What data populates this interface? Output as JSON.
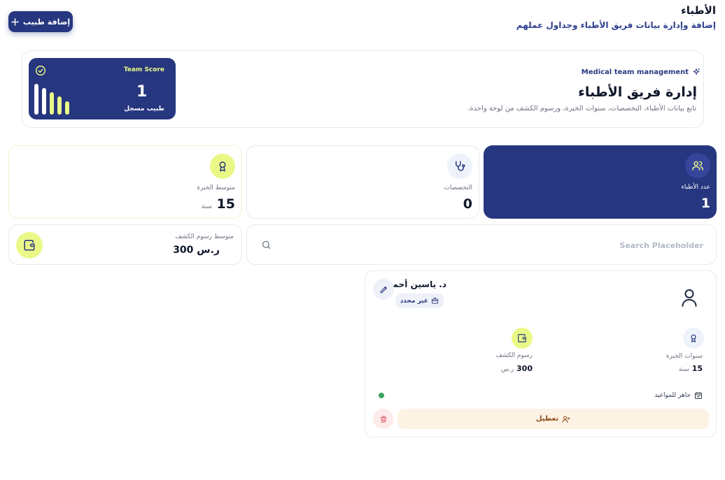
{
  "header": {
    "title": "الأطباء",
    "subtitle": "إضافة وإدارة بيانات فريق الأطباء وجداول عملهم",
    "add_button_label": "إضافة طبيب"
  },
  "hero": {
    "tag": "Medical team management",
    "title": "إدارة فريق الأطباء",
    "description": "تابع بيانات الأطباء، التخصصات، سنوات الخبرة، ورسوم الكشف من لوحة واحدة.",
    "score_label": "Team Score",
    "score_value": "1",
    "score_unit": "طبيب مسجل"
  },
  "stats": {
    "doctors": {
      "label": "عدد الأطباء",
      "value": "1",
      "icon": "users-icon"
    },
    "specialties": {
      "label": "التخصصات",
      "value": "0",
      "icon": "stethoscope-icon"
    },
    "experience": {
      "label": "متوسط الخبرة",
      "value": "15",
      "unit": "سنة",
      "icon": "award-icon"
    }
  },
  "fee": {
    "label": "متوسط رسوم الكشف",
    "value": "300 ر.س",
    "icon": "wallet-icon"
  },
  "search": {
    "placeholder": "Search Placeholder"
  },
  "doctor": {
    "name": "د. ياسين أحمد",
    "specialty": "غير محدد",
    "experience_label": "سنوات الخبرة",
    "experience_value": "15",
    "experience_unit": "سنة",
    "fee_label": "رسوم الكشف",
    "fee_value": "300",
    "fee_unit": "ر.س",
    "status": "جاهز للمواعيد",
    "disable_label": "تعطيل"
  },
  "colors": {
    "primary": "#26367f",
    "accent": "#eaf887",
    "status_ok": "#3aa364",
    "warning_bg": "#fdf3e4",
    "danger": "#e25c6a"
  }
}
